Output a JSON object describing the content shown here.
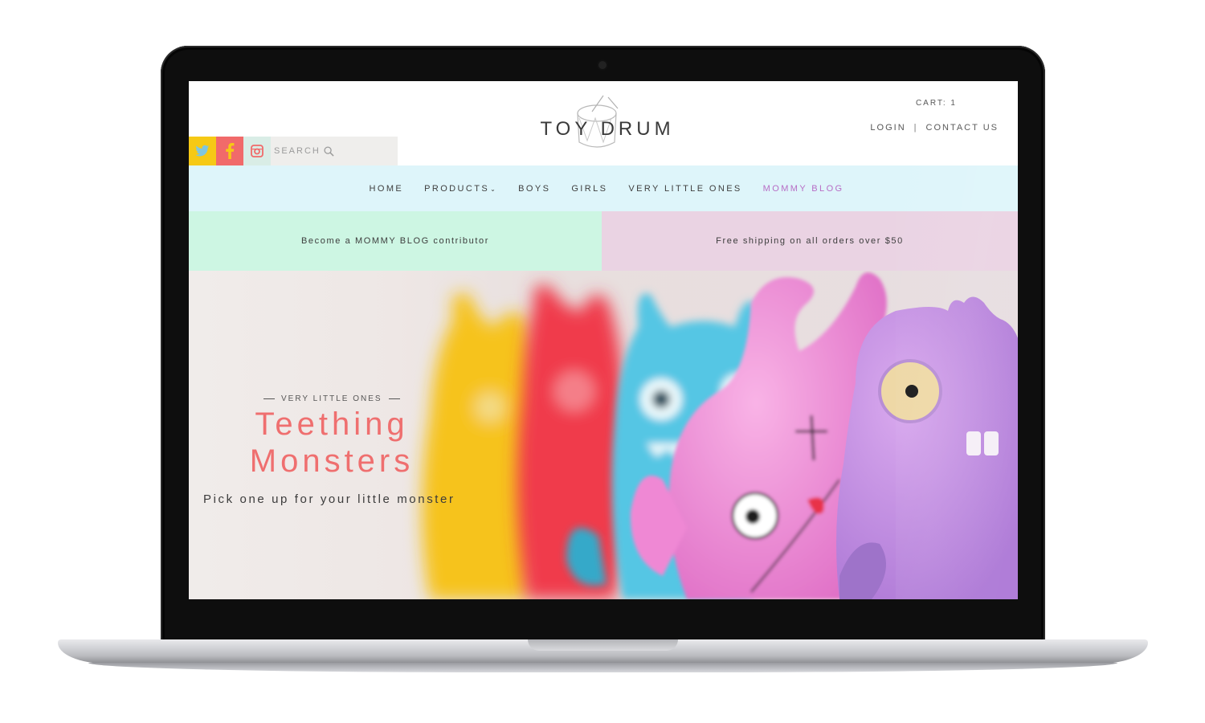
{
  "header": {
    "logo_text": "TOY DRUM",
    "cart_label": "CART: 1",
    "login_label": "LOGIN",
    "separator": "|",
    "contact_label": "CONTACT US"
  },
  "social": {
    "icons": [
      "twitter-icon",
      "facebook-icon",
      "instagram-icon"
    ],
    "colors": {
      "twitter": "#f6c915",
      "facebook": "#f16a6a",
      "instagram": "#d9ede6"
    }
  },
  "search": {
    "placeholder": "SEARCH"
  },
  "nav": {
    "items": [
      {
        "label": "HOME"
      },
      {
        "label": "PRODUCTS"
      },
      {
        "label": "BOYS"
      },
      {
        "label": "GIRLS"
      },
      {
        "label": "VERY LITTLE ONES"
      },
      {
        "label": "MOMMY BLOG",
        "active": true
      }
    ],
    "background": "#def5fa",
    "active_color": "#b76dc5"
  },
  "promos": {
    "left": "Become a MOMMY BLOG contributor",
    "right": "Free shipping on all orders over $50",
    "left_color": "#cdf6e3",
    "right_color": "#ead3e3"
  },
  "hero": {
    "eyebrow": "VERY LITTLE ONES",
    "title_line1": "Teething",
    "title_line2": "Monsters",
    "subtitle": "Pick one up for your little monster",
    "title_color": "#ef6f6f"
  }
}
